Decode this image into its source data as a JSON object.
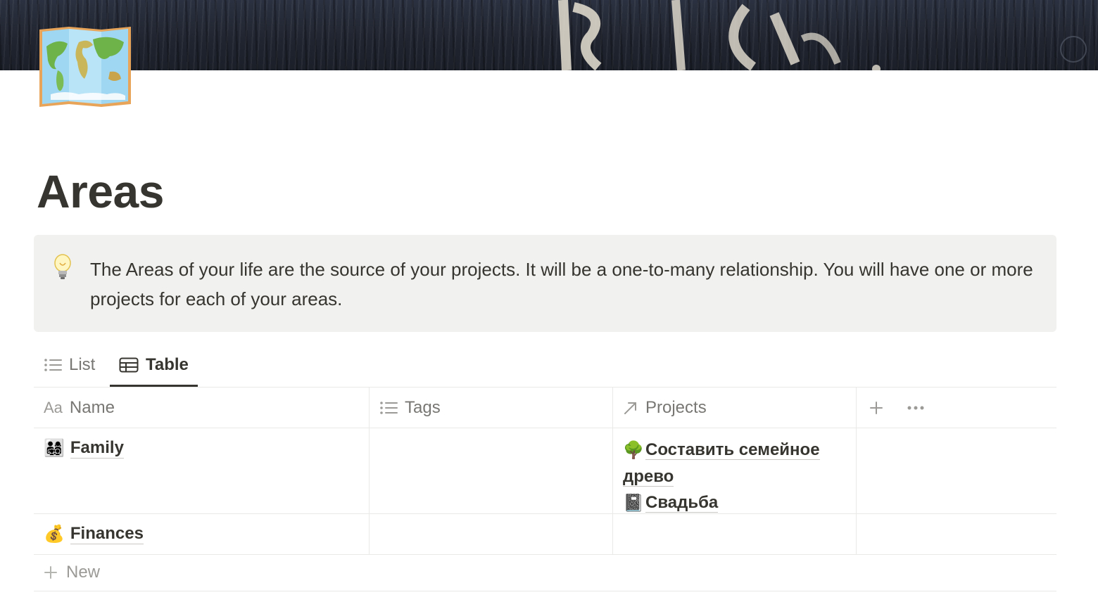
{
  "page": {
    "title": "Areas",
    "icon": "world-map-icon",
    "cover": "dark-wood-graffiti-cover"
  },
  "callout": {
    "icon": "lightbulb-icon",
    "text": "The Areas of your life are the source of your projects. It will be a one-to-many relationship. You will have one or more projects for each of your areas."
  },
  "views": [
    {
      "label": "List",
      "icon": "list-icon",
      "active": false
    },
    {
      "label": "Table",
      "icon": "table-icon",
      "active": true
    }
  ],
  "table": {
    "columns": [
      {
        "label": "Name",
        "icon_text": "Aa"
      },
      {
        "label": "Tags",
        "icon": "multi-select-icon"
      },
      {
        "label": "Projects",
        "icon": "relation-arrow-icon"
      }
    ],
    "add_column_icon": "plus-icon",
    "more_icon": "ellipsis-icon",
    "rows": [
      {
        "name": "Family",
        "emoji": "👨‍👩‍👧‍👦",
        "tags": "",
        "projects": [
          {
            "emoji": "🌳",
            "label": "Составить семейное древо"
          },
          {
            "emoji": "📓",
            "label": "Свадьба"
          }
        ]
      },
      {
        "name": "Finances",
        "emoji": "💰",
        "tags": "",
        "projects": []
      }
    ],
    "new_label": "New"
  },
  "colors": {
    "text": "#37352f",
    "muted": "#787774",
    "callout_bg": "#f1f1ef",
    "border": "#e9e9e7"
  }
}
